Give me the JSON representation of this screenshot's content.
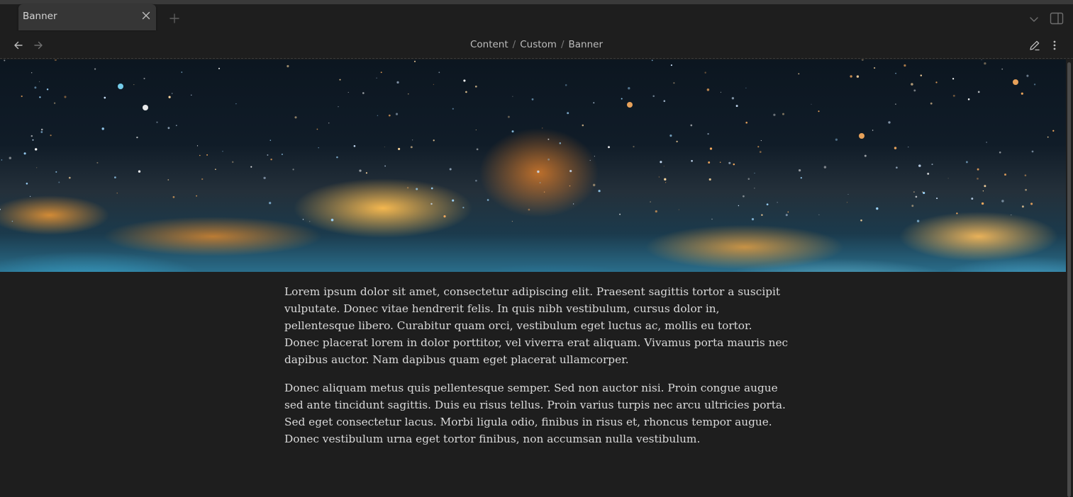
{
  "tabs": {
    "active_title": "Banner"
  },
  "breadcrumb": {
    "items": [
      "Content",
      "Custom",
      "Banner"
    ],
    "separator": "/"
  },
  "icons": {
    "tab_close": "close-icon",
    "new_tab": "plus-icon",
    "tab_list": "chevron-down-icon",
    "sidebar_toggle": "sidebar-toggle-icon",
    "back": "arrow-left-icon",
    "forward": "arrow-right-icon",
    "edit": "pencil-icon",
    "more": "more-vertical-icon"
  },
  "colors": {
    "background": "#1e1e1e",
    "tab_active": "#363636",
    "text": "#dadada",
    "muted": "#7a7a7a"
  },
  "content": {
    "paragraphs": [
      "Lorem ipsum dolor sit amet, consectetur adipiscing elit. Praesent sagittis tortor a suscipit vulputate. Donec vitae hendrerit felis. In quis nibh vestibulum, cursus dolor in, pellentesque libero. Curabitur quam orci, vestibulum eget luctus ac, mollis eu tortor. Donec placerat lorem in dolor porttitor, vel viverra erat aliquam. Vivamus porta mauris nec dapibus auctor. Nam dapibus quam eget placerat ullamcorper.",
      "Donec aliquam metus quis pellentesque semper. Sed non auctor nisi. Proin congue augue sed ante tincidunt sagittis. Duis eu risus tellus. Proin varius turpis nec arcu ultricies porta. Sed eget consectetur lacus. Morbi ligula odio, finibus in risus et, rhoncus tempor augue. Donec vestibulum urna eget tortor finibus, non accumsan nulla vestibulum."
    ]
  }
}
